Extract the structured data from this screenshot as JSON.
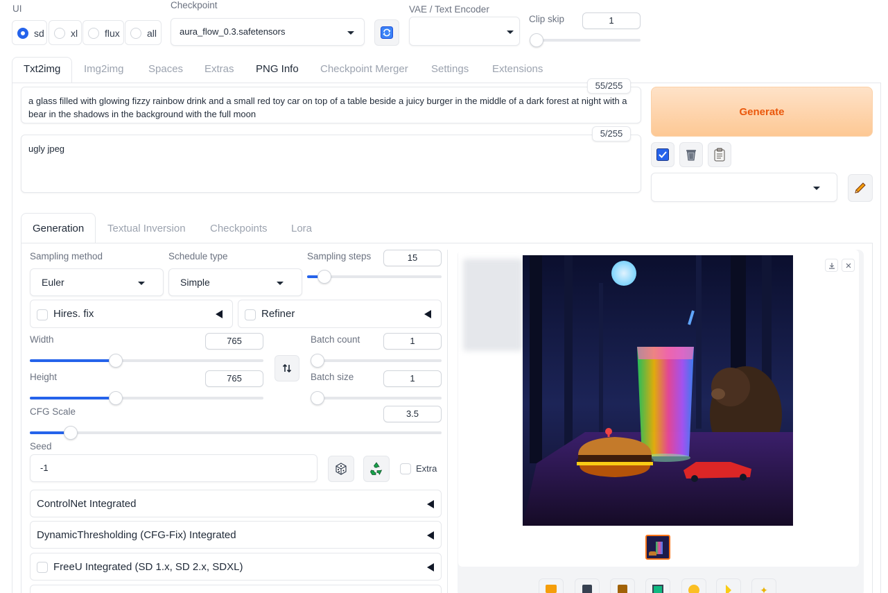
{
  "ui_selector": {
    "label": "UI",
    "options": [
      "sd",
      "xl",
      "flux",
      "all"
    ],
    "selected": "sd"
  },
  "checkpoint": {
    "label": "Checkpoint",
    "value": "aura_flow_0.3.safetensors"
  },
  "vae": {
    "label": "VAE / Text Encoder",
    "value": ""
  },
  "clip_skip": {
    "label": "Clip skip",
    "value": "1",
    "fraction": 0.0
  },
  "main_tabs": [
    "Txt2img",
    "Img2img",
    "Spaces",
    "Extras",
    "PNG Info",
    "Checkpoint Merger",
    "Settings",
    "Extensions"
  ],
  "active_main_tab": "Txt2img",
  "prompt": {
    "text": "a glass filled with glowing fizzy rainbow drink and a small red toy car on top of a table beside a juicy burger in the middle of a dark forest at night with a bear in the shadows in the background with the full moon",
    "token_count": "55/255"
  },
  "negative_prompt": {
    "text": "ugly jpeg",
    "token_count": "5/255"
  },
  "generate_label": "Generate",
  "style_select": {
    "value": ""
  },
  "sub_tabs": [
    "Generation",
    "Textual Inversion",
    "Checkpoints",
    "Lora"
  ],
  "active_sub_tab": "Generation",
  "sampling_method": {
    "label": "Sampling method",
    "value": "Euler"
  },
  "schedule_type": {
    "label": "Schedule type",
    "value": "Simple"
  },
  "sampling_steps": {
    "label": "Sampling steps",
    "value": "15",
    "fraction": 0.13
  },
  "hires_fix": {
    "label": "Hires. fix",
    "checked": false
  },
  "refiner": {
    "label": "Refiner",
    "checked": false
  },
  "width": {
    "label": "Width",
    "value": "765",
    "fraction": 0.367
  },
  "height": {
    "label": "Height",
    "value": "765",
    "fraction": 0.367
  },
  "batch_count": {
    "label": "Batch count",
    "value": "1",
    "fraction": 0.0
  },
  "batch_size": {
    "label": "Batch size",
    "value": "1",
    "fraction": 0.0
  },
  "cfg_scale": {
    "label": "CFG Scale",
    "value": "3.5",
    "fraction": 0.1
  },
  "seed": {
    "label": "Seed",
    "value": "-1"
  },
  "extra": {
    "label": "Extra",
    "checked": false
  },
  "accordions": [
    {
      "label": "ControlNet Integrated",
      "has_checkbox": false
    },
    {
      "label": "DynamicThresholding (CFG-Fix) Integrated",
      "has_checkbox": false
    },
    {
      "label": "FreeU Integrated (SD 1.x, SD 2.x, SDXL)",
      "has_checkbox": true
    }
  ],
  "colors": {
    "accent": "#2563eb",
    "generate_text": "#ea580c",
    "generate_bg_top": "#fed7aa",
    "generate_bg_bottom": "#fdba74"
  },
  "icons": {
    "refresh": "refresh-icon",
    "swap": "swap-icon",
    "dice": "dice-icon",
    "recycle": "recycle-icon",
    "trash": "trash-icon",
    "clipboard": "clipboard-icon",
    "pencil": "pencil-icon",
    "download": "download-icon",
    "close": "close-icon"
  }
}
